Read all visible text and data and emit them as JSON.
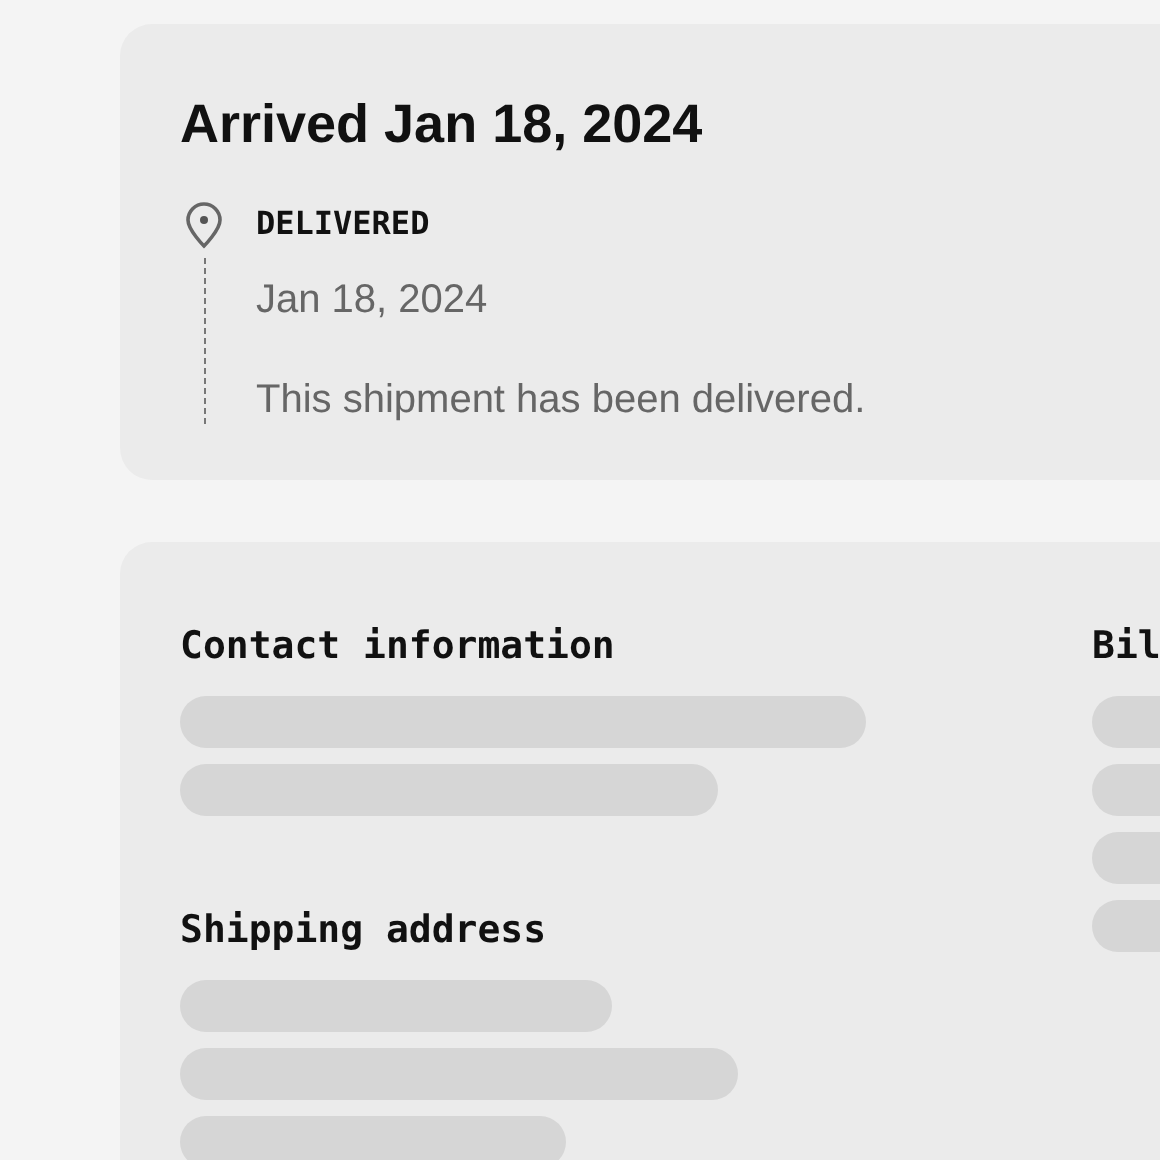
{
  "shipment": {
    "title": "Arrived Jan 18, 2024",
    "events": [
      {
        "status": "DELIVERED",
        "date": "Jan 18, 2024",
        "description": "This shipment has been delivered."
      }
    ]
  },
  "details": {
    "sections": [
      {
        "heading": "Contact information",
        "loading": true
      },
      {
        "heading": "Shipping address",
        "loading": true
      },
      {
        "heading": "Bil",
        "loading": true
      }
    ]
  }
}
